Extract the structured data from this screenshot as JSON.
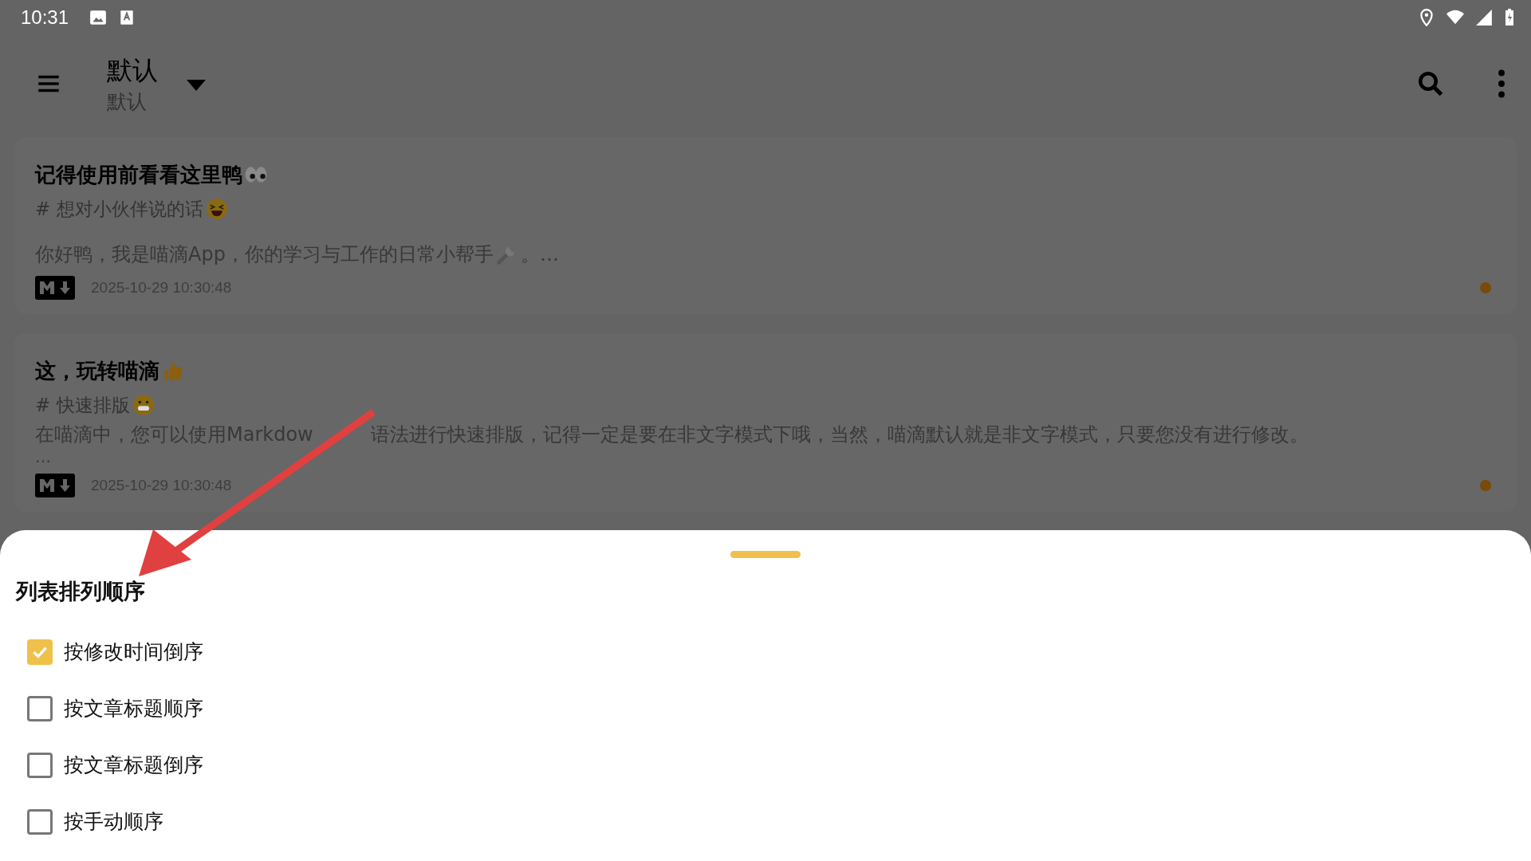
{
  "status_bar": {
    "time": "10:31"
  },
  "toolbar": {
    "title": "默认",
    "subtitle": "默认"
  },
  "notes": [
    {
      "title": "记得使用前看看这里鸭",
      "tag": "# 想对小伙伴说的话",
      "excerpt": [
        "你好鸭，我是喵滴App，你的学习与工作的日常小帮手",
        "。…"
      ],
      "date": "2025-10-29 10:30:48",
      "color": "#7a4a08"
    },
    {
      "title": "这，玩转喵滴",
      "tag": "# 快速排版",
      "excerpt": [
        "在喵滴中，您可以使用Markdow",
        "语法进行快速排版，记得一定是要在非文字模式下哦，当然，喵滴默认就是非文字模式，只要您没有进行修改。"
      ],
      "ellipsis": "…",
      "date": "2025-10-29 10:30:48",
      "color": "#7a4a08"
    }
  ],
  "sort_sheet": {
    "title": "列表排列顺序",
    "options": [
      {
        "label": "按修改时间倒序",
        "checked": true
      },
      {
        "label": "按文章标题顺序",
        "checked": false
      },
      {
        "label": "按文章标题倒序",
        "checked": false
      },
      {
        "label": "按手动顺序",
        "checked": false
      }
    ]
  }
}
